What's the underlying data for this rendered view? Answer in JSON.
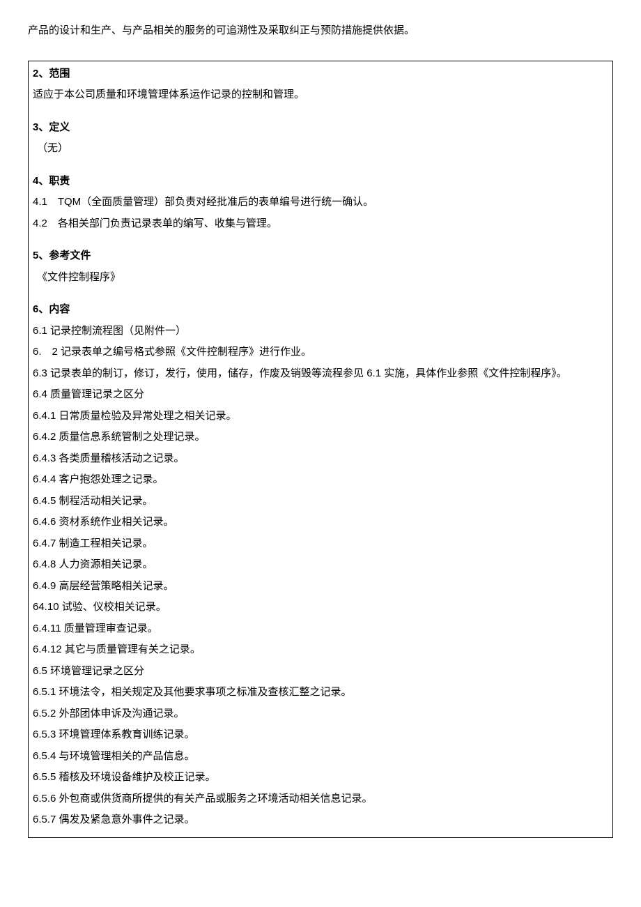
{
  "intro": "产品的设计和生产、与产品相关的服务的可追溯性及采取纠正与预防措施提供依据。",
  "s2": {
    "num": "2",
    "sep": "、",
    "title": "范围",
    "body": "适应于本公司质量和环境管理体系运作记录的控制和管理。"
  },
  "s3": {
    "num": "3",
    "sep": "、",
    "title": "定义",
    "body": "（无）"
  },
  "s4": {
    "num": "4",
    "sep": "、",
    "title": "职责",
    "l1": "4.1　TQM（全面质量管理）部负责对经批准后的表单编号进行统一确认。",
    "l2": "4.2　各相关部门负责记录表单的编写、收集与管理。"
  },
  "s5": {
    "num": "5",
    "sep": "、",
    "title": "参考文件",
    "body": "《文件控制程序》"
  },
  "s6": {
    "num": "6",
    "sep": "、",
    "title": "内容",
    "l1": "6.1 记录控制流程图（见附件一）",
    "l2": "6.　2 记录表单之编号格式参照《文件控制程序》进行作业。",
    "l3": "6.3 记录表单的制订，修订，发行，使用，储存，作废及销毁等流程参见 6.1 实施，具体作业参照《文件控制程序》。",
    "l4": "6.4 质量管理记录之区分",
    "l4_1": "6.4.1 日常质量检验及异常处理之相关记录。",
    "l4_2": "6.4.2 质量信息系统管制之处理记录。",
    "l4_3": "6.4.3 各类质量稽核活动之记录。",
    "l4_4": "6.4.4 客户抱怨处理之记录。",
    "l4_5": "6.4.5 制程活动相关记录。",
    "l4_6": "6.4.6 资材系统作业相关记录。",
    "l4_7": "6.4.7 制造工程相关记录。",
    "l4_8": "6.4.8 人力资源相关记录。",
    "l4_9": "6.4.9 高层经营策略相关记录。",
    "l4_10": "64.10 试验、仪校相关记录。",
    "l4_11": "6.4.11 质量管理审查记录。",
    "l4_12": "6.4.12 其它与质量管理有关之记录。",
    "l5": "6.5 环境管理记录之区分",
    "l5_1": "6.5.1 环境法令，相关规定及其他要求事项之标准及查核汇整之记录。",
    "l5_2": "6.5.2 外部团体申诉及沟通记录。",
    "l5_3": "6.5.3 环境管理体系教育训练记录。",
    "l5_4": "6.5.4 与环境管理相关的产品信息。",
    "l5_5": "6.5.5 稽核及环境设备维护及校正记录。",
    "l5_6": "6.5.6 外包商或供货商所提供的有关产品或服务之环境活动相关信息记录。",
    "l5_7": "6.5.7 偶发及紧急意外事件之记录。"
  }
}
